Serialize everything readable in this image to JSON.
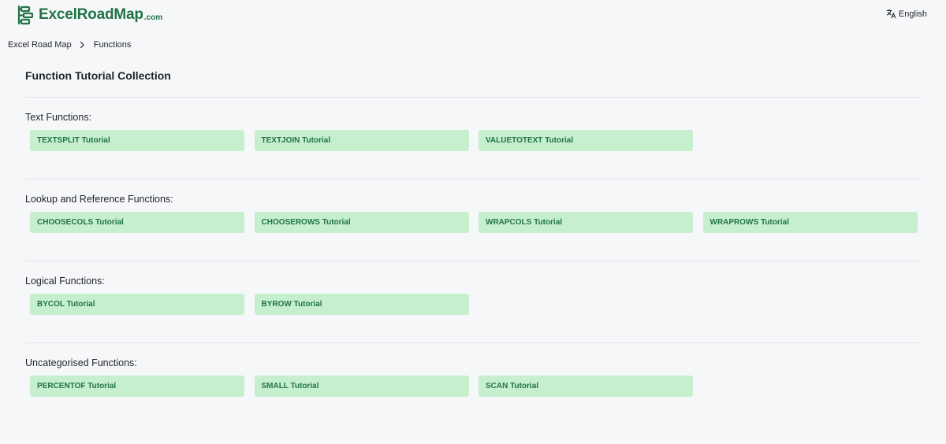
{
  "brand": {
    "name": "ExcelRoadMap",
    "tld": ".com",
    "color": "#217346"
  },
  "language": {
    "label": "English",
    "icon": "translate-icon"
  },
  "breadcrumb": {
    "items": [
      "Excel Road Map",
      "Functions"
    ],
    "separator_icon": "chevron-right-icon"
  },
  "page": {
    "title": "Function Tutorial Collection"
  },
  "colors": {
    "button_bg": "#c6efce",
    "button_text": "#217346",
    "background": "#f6f7f9"
  },
  "sections": [
    {
      "title": "Text Functions:",
      "tutorials": [
        "TEXTSPLIT Tutorial",
        "TEXTJOIN Tutorial",
        "VALUETOTEXT Tutorial"
      ]
    },
    {
      "title": "Lookup and Reference Functions:",
      "tutorials": [
        "CHOOSECOLS Tutorial",
        "CHOOSEROWS Tutorial",
        "WRAPCOLS Tutorial",
        "WRAPROWS Tutorial"
      ]
    },
    {
      "title": "Logical Functions:",
      "tutorials": [
        "BYCOL Tutorial",
        "BYROW Tutorial"
      ]
    },
    {
      "title": "Uncategorised Functions:",
      "tutorials": [
        "PERCENTOF Tutorial",
        "SMALL Tutorial",
        "SCAN Tutorial"
      ]
    }
  ]
}
